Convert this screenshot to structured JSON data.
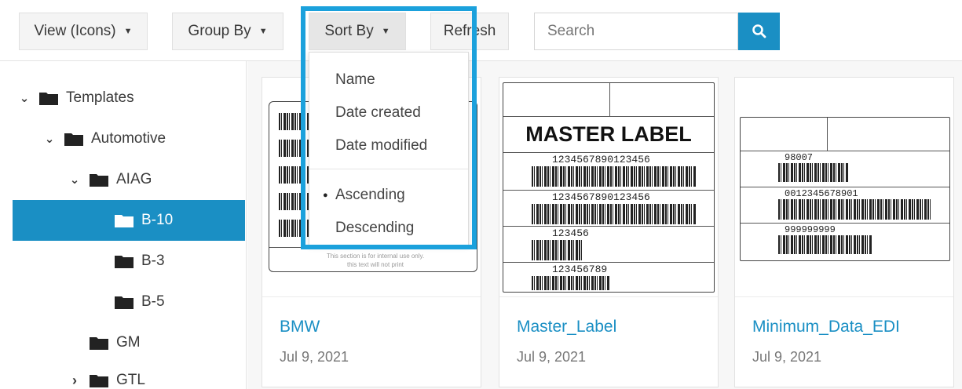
{
  "toolbar": {
    "view_label": "View (Icons)",
    "group_label": "Group By",
    "sort_label": "Sort By",
    "refresh_label": "Refresh",
    "search_placeholder": "Search",
    "search_icon": "search-icon",
    "accent": "#1a8fc4"
  },
  "sort_menu": {
    "items": [
      {
        "label": "Name"
      },
      {
        "label": "Date created"
      },
      {
        "label": "Date modified"
      }
    ],
    "order": [
      {
        "label": "Ascending",
        "selected": true
      },
      {
        "label": "Descending",
        "selected": false
      }
    ]
  },
  "tree": {
    "items": [
      {
        "label": "Templates",
        "expander": "expanded"
      },
      {
        "label": "Automotive",
        "expander": "expanded"
      },
      {
        "label": "AIAG",
        "expander": "expanded"
      },
      {
        "label": "B-10",
        "expander": "none",
        "selected": true
      },
      {
        "label": "B-3",
        "expander": "none"
      },
      {
        "label": "B-5",
        "expander": "none"
      },
      {
        "label": "GM",
        "expander": "none"
      },
      {
        "label": "GTL",
        "expander": "collapsed"
      }
    ]
  },
  "cards": [
    {
      "title": "BMW",
      "date": "Jul 9, 2021",
      "footer_line1": "This section is for internal use only.",
      "footer_line2": "this text will not print"
    },
    {
      "title": "Master_Label",
      "date": "Jul 9, 2021",
      "heading": "MASTER LABEL",
      "numbers": [
        "1234567890123456",
        "1234567890123456",
        "123456",
        "123456789"
      ]
    },
    {
      "title": "Minimum_Data_EDI",
      "date": "Jul 9, 2021",
      "numbers": [
        "98007",
        "0012345678901",
        "999999999"
      ]
    }
  ]
}
